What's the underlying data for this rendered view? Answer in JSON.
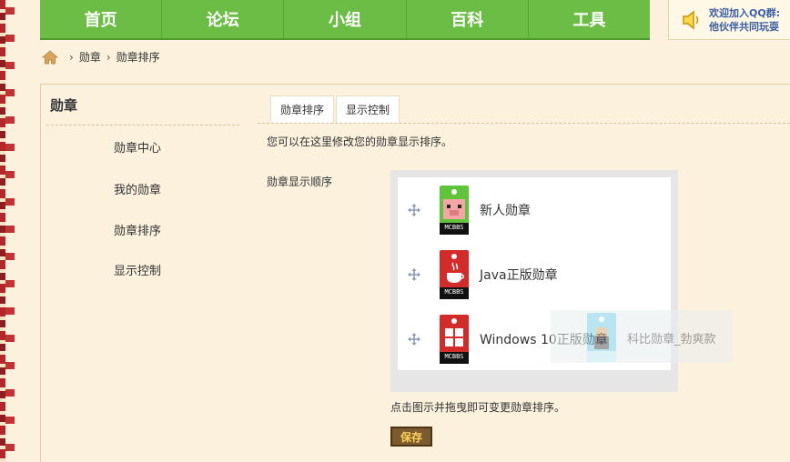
{
  "nav": {
    "items": [
      "首页",
      "论坛",
      "小组",
      "百科",
      "工具"
    ],
    "accent": "#6cbd45"
  },
  "notice": {
    "icon": "speaker-icon",
    "line1": "欢迎加入QQ群:",
    "line2": "他伙伴共同玩耍"
  },
  "breadcrumb": {
    "home_icon": "home-icon",
    "items": [
      "勋章",
      "勋章排序"
    ]
  },
  "sidebar": {
    "title": "勋章",
    "items": [
      "勋章中心",
      "我的勋章",
      "勋章排序",
      "显示控制"
    ]
  },
  "tabs": [
    "勋章排序",
    "显示控制"
  ],
  "main": {
    "description": "您可以在这里修改您的勋章显示排序。",
    "order_label": "勋章显示顺序",
    "medals": [
      {
        "name": "新人勋章",
        "badge_color": "#5fc43a",
        "icon": "pig-face-icon"
      },
      {
        "name": "Java正版勋章",
        "badge_color": "#d32a2a",
        "icon": "java-cup-icon"
      },
      {
        "name": "Windows 10正版勋章",
        "badge_color": "#d32a2a",
        "icon": "windows-logo-icon"
      }
    ],
    "dragging_medal": {
      "name": "科比勋章_勃爽款",
      "badge_color": "#7fd0e6",
      "icon": "figure-icon"
    },
    "badge_text": "MCBBS",
    "hint": "点击图示并拖曳即可变更勋章排序。",
    "save_label": "保存"
  }
}
